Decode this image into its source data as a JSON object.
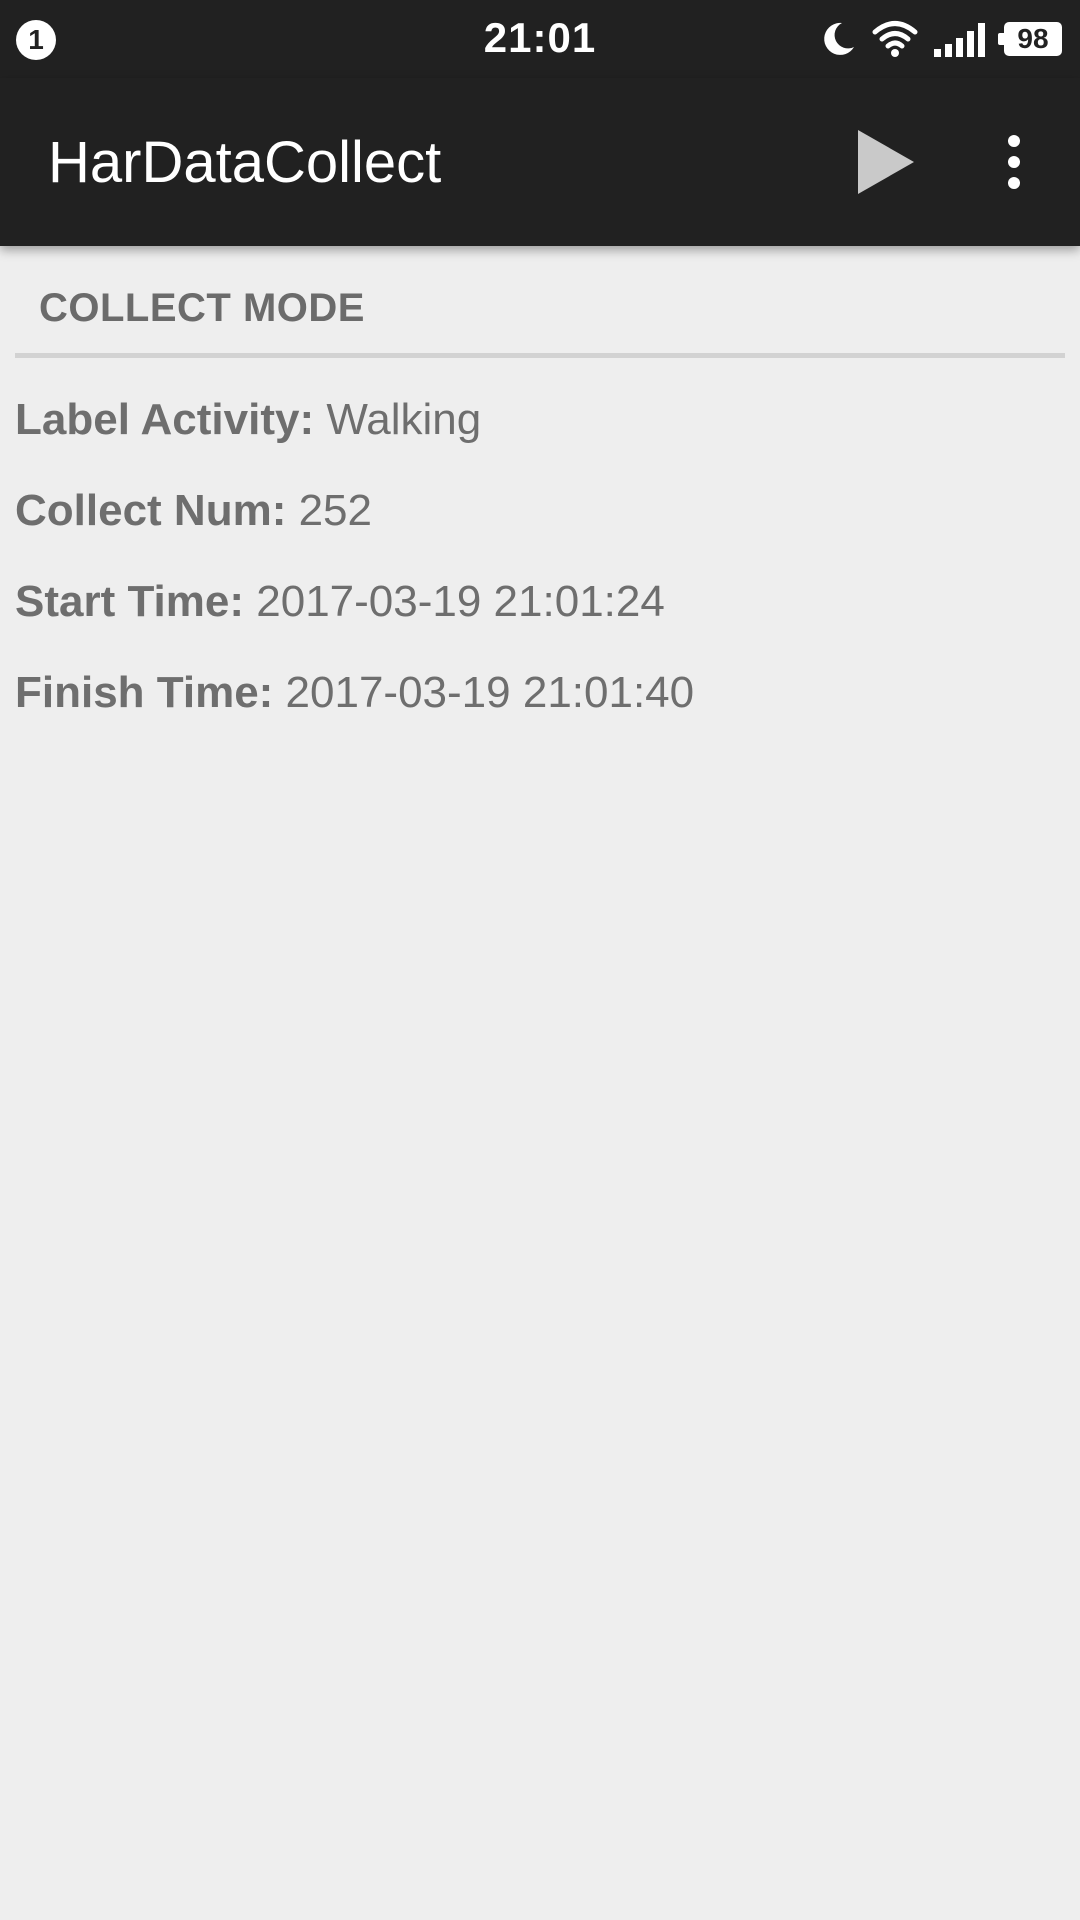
{
  "status_bar": {
    "notification_count": "1",
    "time": "21:01",
    "battery_level": "98",
    "icons": [
      "do-not-disturb-moon-icon",
      "wifi-icon",
      "cell-signal-icon",
      "battery-icon"
    ]
  },
  "app_bar": {
    "title": "HarDataCollect",
    "actions": [
      "play-icon",
      "more-vert-icon"
    ],
    "icon_color": "#c9c9c9"
  },
  "section": {
    "title": "COLLECT MODE"
  },
  "info": {
    "label_activity": {
      "label": "Label Activity:",
      "value": " Walking"
    },
    "collect_num": {
      "label": "Collect Num:",
      "value": " 252"
    },
    "start_time": {
      "label": "Start Time:",
      "value": " 2017-03-19 21:01:24"
    },
    "finish_time": {
      "label": "Finish Time:",
      "value": " 2017-03-19 21:01:40"
    }
  },
  "colors": {
    "bar_background": "#212121",
    "page_background": "#eeeeee",
    "text": "#6e6e6e",
    "divider": "#d2d2d2"
  }
}
